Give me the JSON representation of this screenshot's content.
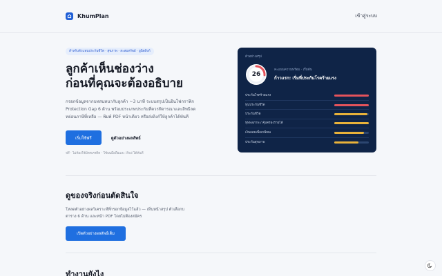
{
  "header": {
    "brand": "KhumPlan",
    "login": "เข้าสู่ระบบ"
  },
  "hero": {
    "badge": "สำหรับตัวแทนประกันชีวิต · สุขภาพ · สะสมทรัพย์ · ยูนิตลิงก์",
    "title_line1": "ลูกค้าเห็นช่องว่าง",
    "title_line2": "ก่อนที่คุณจะต้องอธิบาย",
    "description": "กรอกข้อมูลจากบทสนทนากับลูกค้า ~3 นาที ระบบสรุปเป็นอินโฟกราฟิก Protection Gap 6 ด้าน พร้อมประเภทประกันที่ควรพิจารณาและสิทธิลดหย่อนภาษีที่เหลือ — พิมพ์ PDF หน้าเดียว หรือส่งลิงก์ให้ลูกค้าได้ทันที",
    "primary_cta": "เริ่มใช้ฟรี",
    "secondary_cta": "ดูตัวอย่างผลลัพธ์",
    "note": "ฟรี · ไม่ต้องใช้บัตรเครดิต · ใช้บนมือถือและ iPad ได้ทันที"
  },
  "preview": {
    "label": "ตัวอย่างสรุป",
    "score": "26",
    "score_fraction": 0.26,
    "score_sub": "คะแนนความพร้อม · เริ่มต้น",
    "score_main": "ก้าวแรก: เริ่มที่ประกันโรคร้ายแรง",
    "gaps": [
      {
        "name": "ประกันโรคร้ายแรง",
        "level": 1.0,
        "color": "#e5535b"
      },
      {
        "name": "ทุนประกันชีวิต",
        "level": 1.0,
        "color": "#e5535b"
      },
      {
        "name": "ประกันชีวิต",
        "level": 0.95,
        "color": "#e8b23a"
      },
      {
        "name": "ทุพพลภาพ / คุ้มครองรายได้",
        "level": 1.0,
        "color": "#e8b23a"
      },
      {
        "name": "เงินออมเพื่อเกษียณ",
        "level": 0.85,
        "color": "#e8b23a"
      },
      {
        "name": "ประกันสุขภาพ",
        "level": 0.7,
        "color": "#e8b23a"
      }
    ]
  },
  "section2": {
    "title": "ดูของจริงก่อนตัดสินใจ",
    "description": "โหลดตัวอย่างผลวิเคราะห์ที่กรอกข้อมูลไว้แล้ว — เห็นหน้าสรุป ตัวเลือกบ ตาราง 6 ด้าน และหน้า PDF โดยไม่ต้องสมัคร",
    "cta": "เปิดตัวอย่างผลลัพธ์เต็ม"
  },
  "section3": {
    "title": "ทำงานยังไง"
  },
  "colors": {
    "accent": "#1f6fe0",
    "card_bg": "#0f2447",
    "gauge": "#e5535b"
  }
}
